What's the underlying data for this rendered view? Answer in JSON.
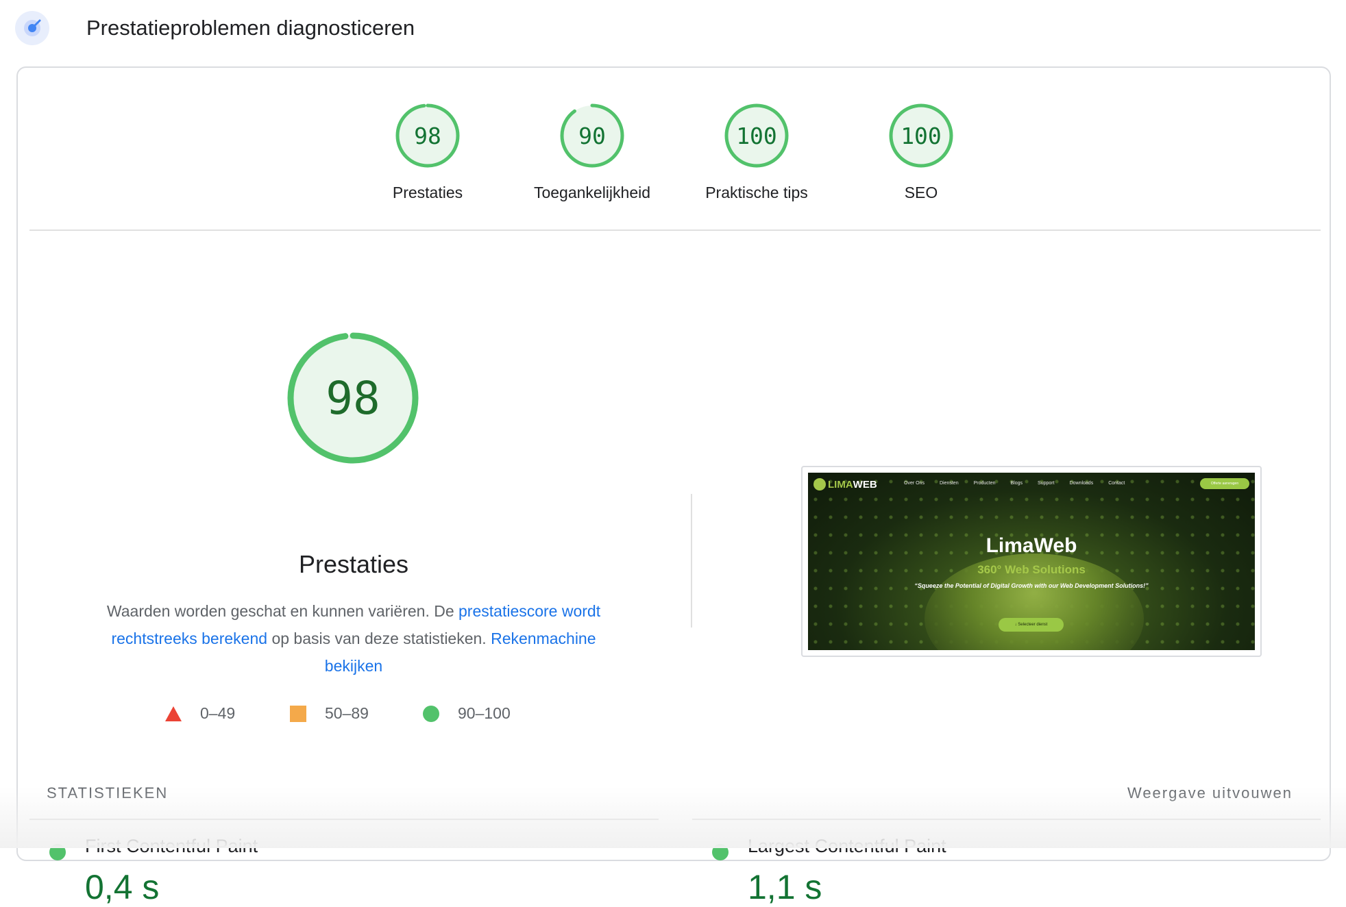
{
  "header": {
    "title": "Prestatieproblemen diagnosticeren",
    "icon": "lighthouse-gauge-icon"
  },
  "categories": [
    {
      "score": 98,
      "label": "Prestaties"
    },
    {
      "score": 90,
      "label": "Toegankelijkheid"
    },
    {
      "score": 100,
      "label": "Praktische tips"
    },
    {
      "score": 100,
      "label": "SEO"
    }
  ],
  "performance": {
    "score": 98,
    "title": "Prestaties",
    "desc_part1": "Waarden worden geschat en kunnen variëren. De ",
    "link1": "prestatiescore wordt rechtstreeks berekend",
    "desc_part2": " op basis van deze statistieken. ",
    "link2": "Rekenmachine bekijken"
  },
  "legend": [
    {
      "range": "0–49",
      "shape": "red-triangle-icon",
      "color": "#eb4335"
    },
    {
      "range": "50–89",
      "shape": "orange-square-icon",
      "color": "#f4a94a"
    },
    {
      "range": "90–100",
      "shape": "green-circle-icon",
      "color": "#52c26b"
    }
  ],
  "screenshot": {
    "logo_lima": "LIMA",
    "logo_web": "WEB",
    "nav": [
      "Over Ons",
      "Diensten",
      "Producten",
      "Blogs",
      "Support",
      "Downloads",
      "Contact"
    ],
    "cta": "Offerte aanvragen",
    "headline": "LimaWeb",
    "subheadline": "360° Web Solutions",
    "quote": "“Squeeze the Potential of Digital Growth with our Web Development Solutions!”",
    "button": "↓ Selecteer dienst"
  },
  "metrics_section": {
    "label": "STATISTIEKEN",
    "expand": "Weergave uitvouwen"
  },
  "metrics": [
    {
      "name": "First Contentful Paint",
      "value": "0,4 s"
    },
    {
      "name": "Largest Contentful Paint",
      "value": "1,1 s"
    }
  ],
  "colors": {
    "good": "#52c26b",
    "good_text": "#137333",
    "good_fill": "#eaf6ec",
    "link": "#1a73e8"
  }
}
